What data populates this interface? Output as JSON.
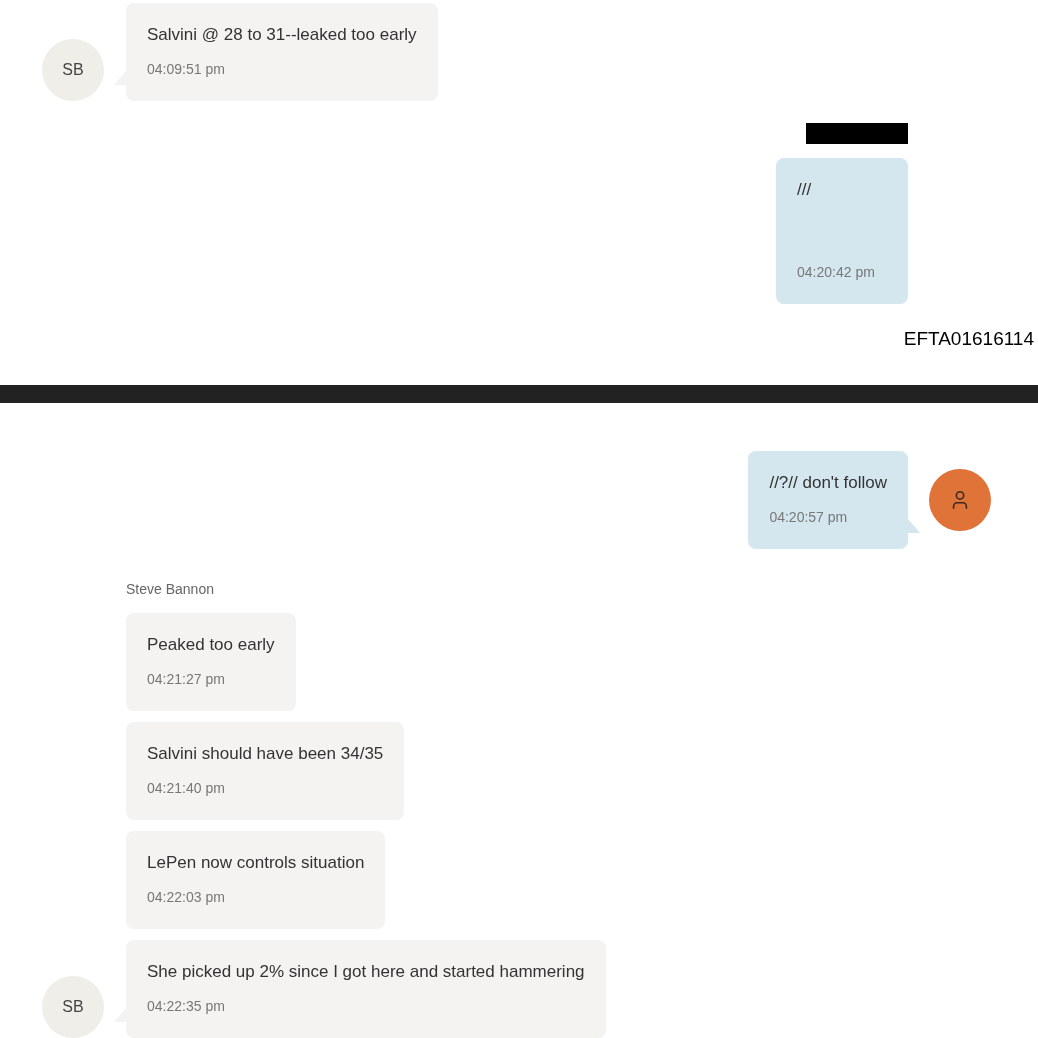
{
  "pages": [
    {
      "messages": [
        {
          "kind": "incoming",
          "avatar": {
            "kind": "initials",
            "text": "SB"
          },
          "redacted": false,
          "text": "Salvini @ 28 to 31--leaked too early",
          "time": "04:09:51 pm"
        },
        {
          "kind": "outgoing",
          "redacted": true,
          "text": "///",
          "time": "04:20:42 pm"
        }
      ],
      "stamp": "EFTA01616114"
    },
    {
      "messages": [
        {
          "kind": "outgoing",
          "avatar": {
            "kind": "person"
          },
          "redacted": false,
          "text": "//?// don't follow",
          "time": "04:20:57 pm"
        },
        {
          "kind": "incoming",
          "sender": "Steve Bannon",
          "redacted": false,
          "text": "Peaked too early",
          "time": "04:21:27 pm"
        },
        {
          "kind": "incoming",
          "redacted": false,
          "text": "Salvini should have been 34/35",
          "time": "04:21:40 pm"
        },
        {
          "kind": "incoming",
          "redacted": false,
          "text": "LePen now controls situation",
          "time": "04:22:03 pm"
        },
        {
          "kind": "incoming",
          "avatar": {
            "kind": "initials",
            "text": "SB"
          },
          "redacted": false,
          "text": "She picked up 2% since I got here and started hammering",
          "time": "04:22:35 pm"
        }
      ]
    }
  ]
}
